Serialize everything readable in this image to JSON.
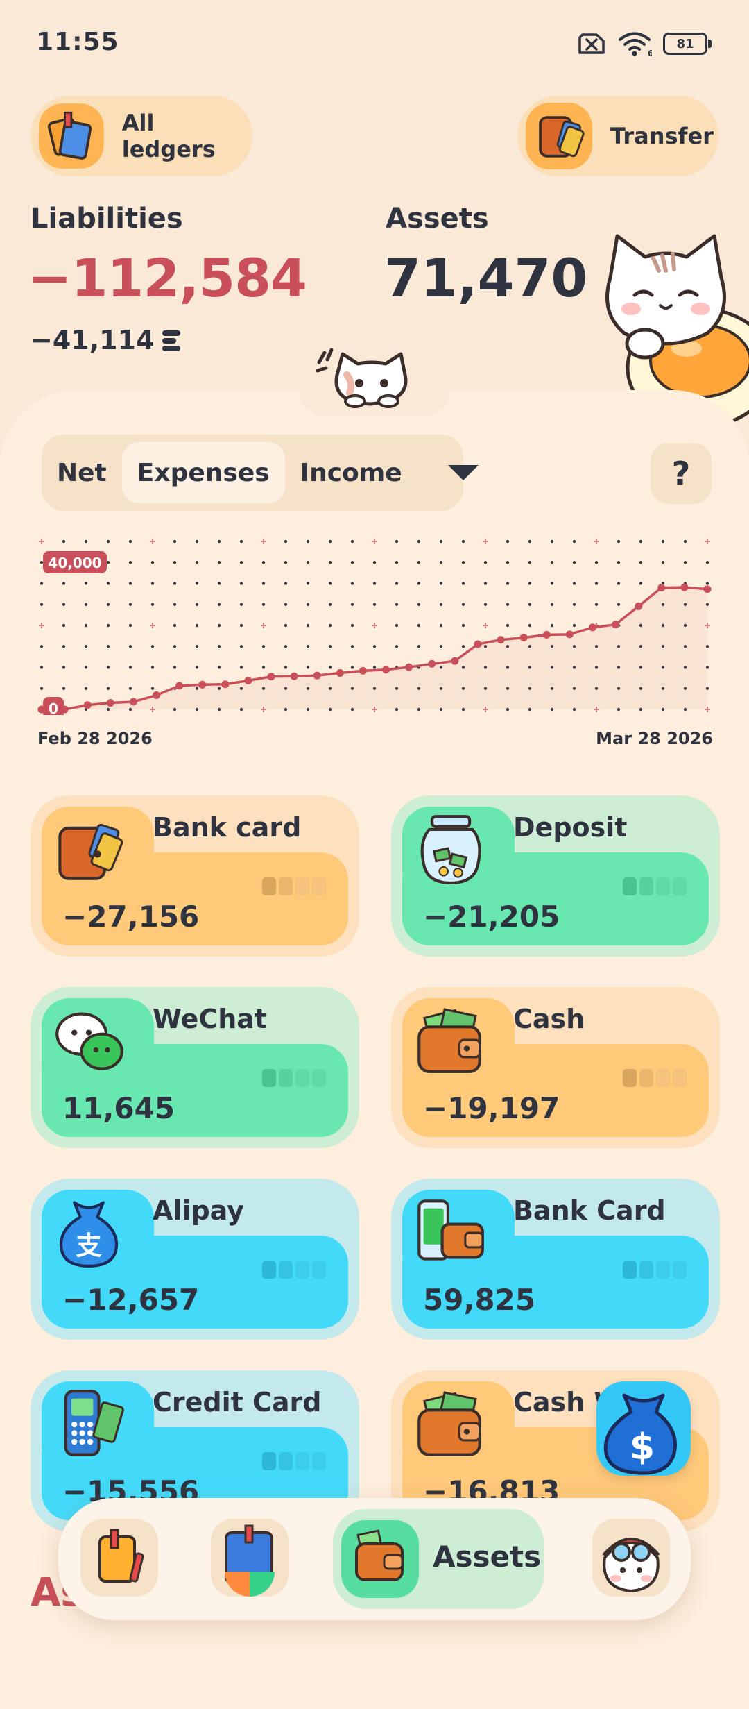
{
  "status_bar": {
    "time": "11:55",
    "battery": "81",
    "wifi_badge": "6"
  },
  "header": {
    "ledgers_label": "All ledgers",
    "transfer_label": "Transfer"
  },
  "summary": {
    "liabilities_label": "Liabilities",
    "liabilities_value": "−112,584",
    "net_value": "−41,114",
    "assets_label": "Assets",
    "assets_value": "71,470"
  },
  "segment": {
    "options": [
      "Net",
      "Expenses",
      "Income"
    ],
    "selected": "Expenses",
    "help_label": "?"
  },
  "chart_data": {
    "type": "line",
    "x_start_label": "Feb 28 2026",
    "x_end_label": "Mar 28 2026",
    "ylim": [
      0,
      40000
    ],
    "y_labels": [
      "40,000",
      "0"
    ],
    "values": [
      0,
      0,
      1200,
      1800,
      2100,
      3900,
      6500,
      6800,
      6900,
      7900,
      9000,
      9100,
      9300,
      10000,
      10600,
      10900,
      11600,
      12500,
      13300,
      17900,
      19100,
      19700,
      20500,
      20600,
      22500,
      23300,
      28300,
      33400,
      33500,
      33000
    ],
    "color": "#c94f5a"
  },
  "accounts": [
    {
      "name": "Bank card",
      "amount": "−27,156",
      "color": "orange",
      "icon": "wallet-cards-icon"
    },
    {
      "name": "Deposit",
      "amount": "−21,205",
      "color": "green",
      "icon": "money-jar-icon"
    },
    {
      "name": "WeChat",
      "amount": "11,645",
      "color": "green",
      "icon": "wechat-icon"
    },
    {
      "name": "Cash",
      "amount": "−19,197",
      "color": "orange",
      "icon": "cash-wallet-icon"
    },
    {
      "name": "Alipay",
      "amount": "−12,657",
      "color": "blue",
      "icon": "alipay-bag-icon"
    },
    {
      "name": "Bank Card",
      "amount": "59,825",
      "color": "blue",
      "icon": "phone-wallet-icon"
    },
    {
      "name": "Credit Card",
      "amount": "−15,556",
      "color": "blue",
      "icon": "card-reader-icon"
    },
    {
      "name": "Cash W",
      "amount": "−16,813",
      "color": "orange",
      "icon": "cash-wallet-icon"
    }
  ],
  "bottom_nav": {
    "active_label": "Assets"
  },
  "peek_text": "As"
}
